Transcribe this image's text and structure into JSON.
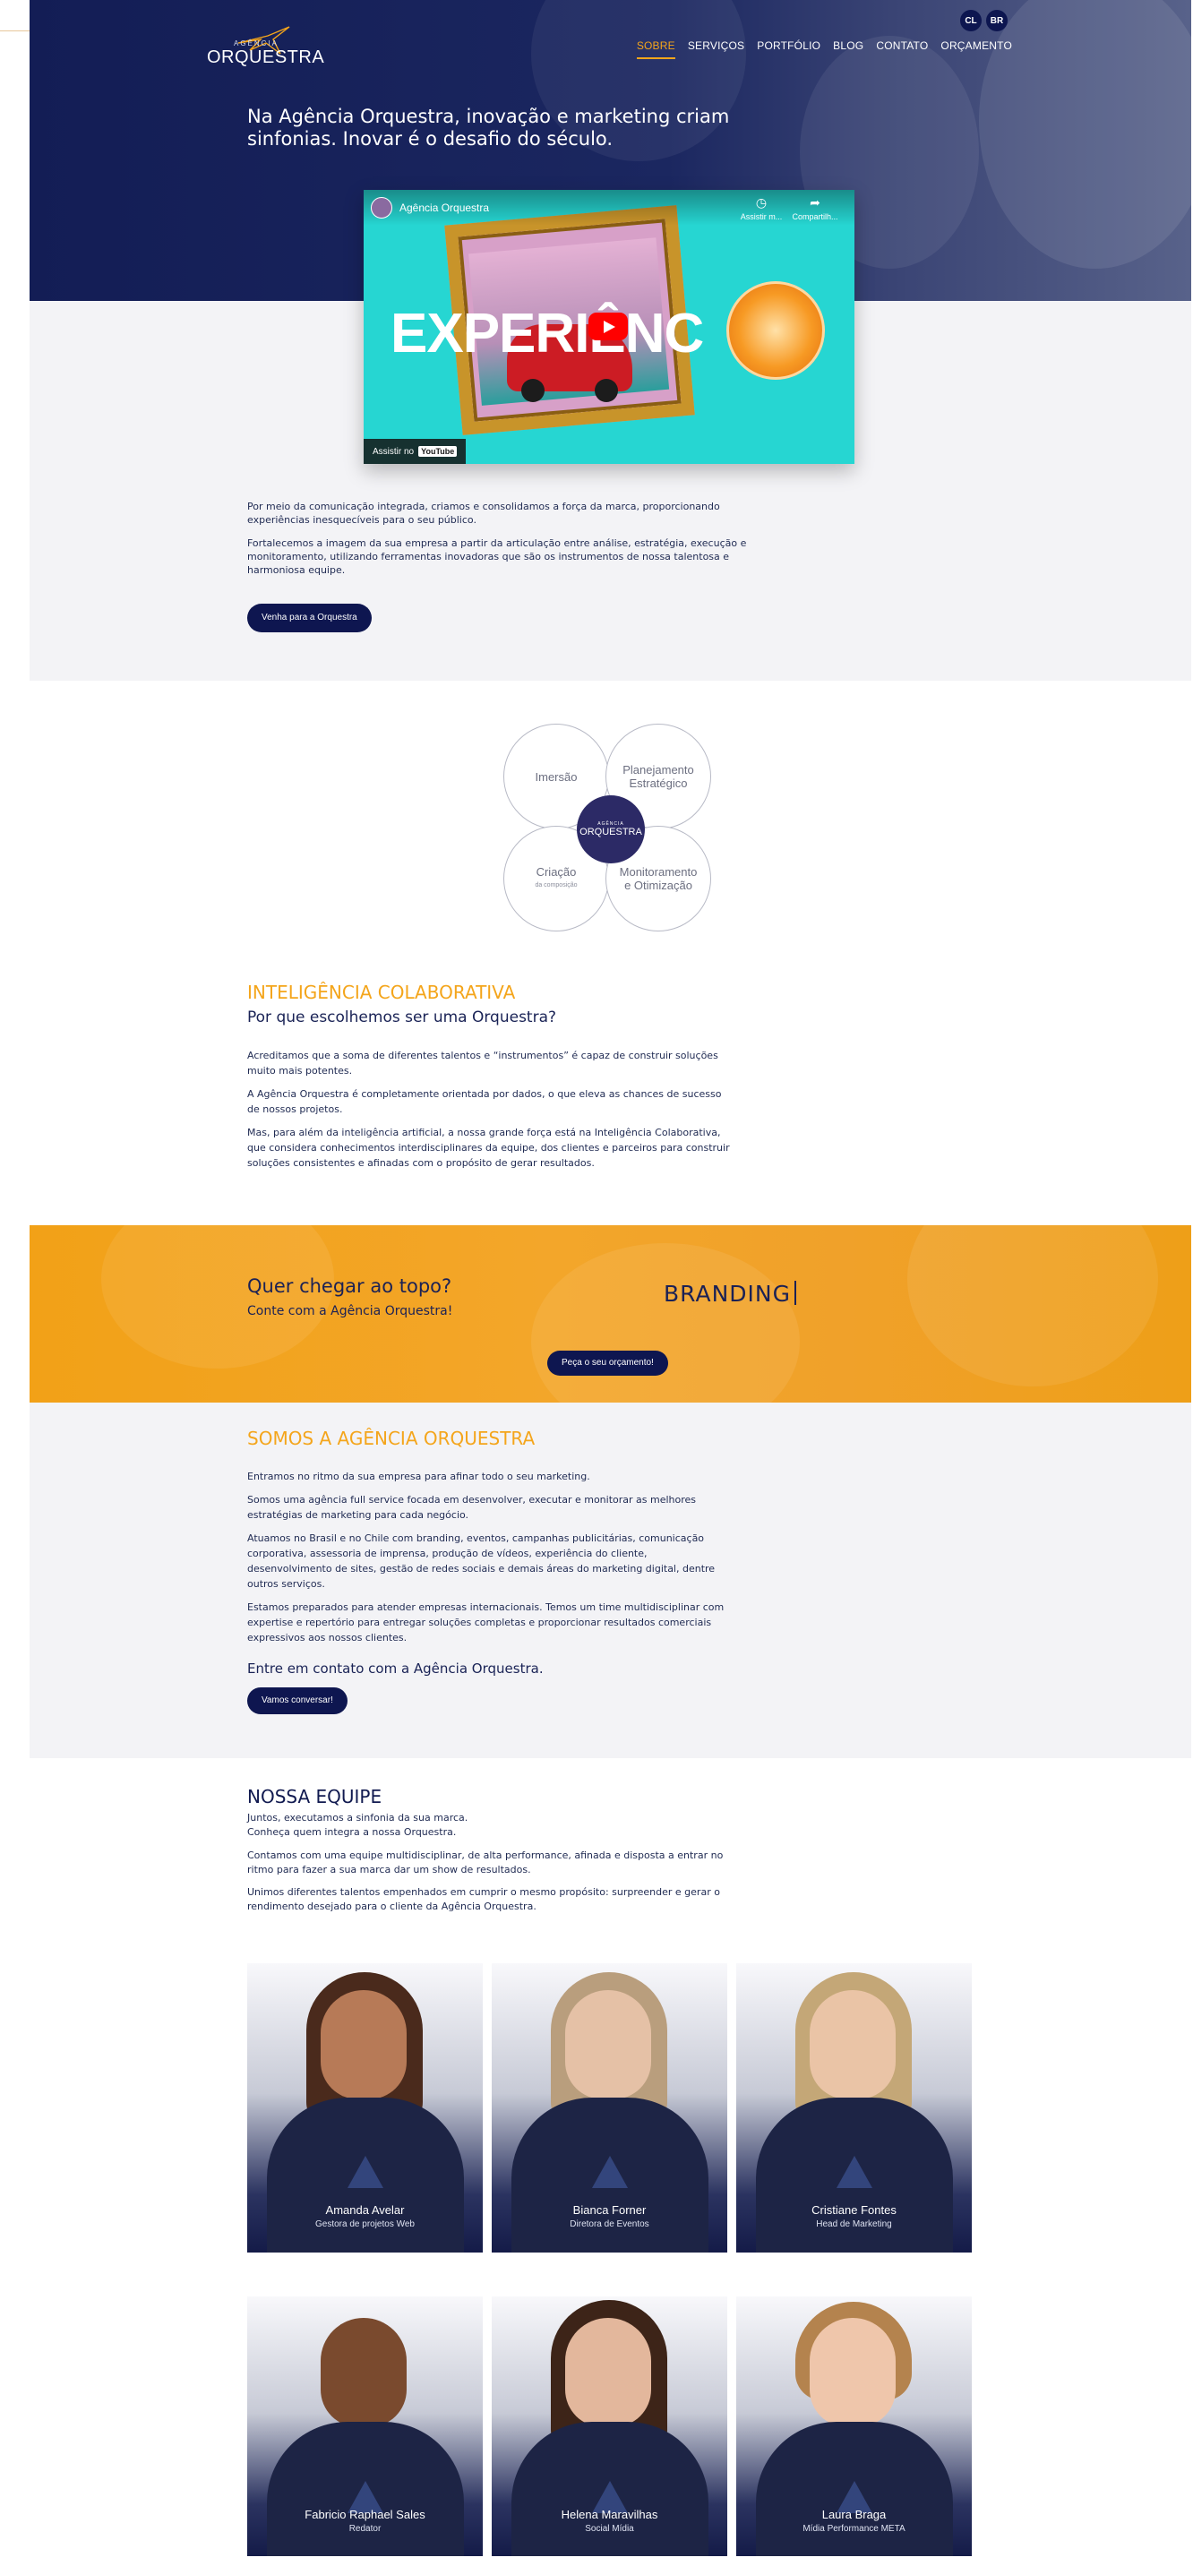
{
  "header": {
    "logo_small": "AGÊNCIA",
    "logo_big": "ORQUESTRA",
    "languages": [
      "CL",
      "BR"
    ],
    "nav": [
      {
        "label": "SOBRE",
        "active": true
      },
      {
        "label": "SERVIÇOS",
        "active": false
      },
      {
        "label": "PORTFÓLIO",
        "active": false
      },
      {
        "label": "BLOG",
        "active": false
      },
      {
        "label": "CONTATO",
        "active": false
      },
      {
        "label": "ORÇAMENTO",
        "active": false
      }
    ],
    "accent_color": "#f4a51b"
  },
  "hero": {
    "headline": "Na Agência Orquestra, inovação e marketing criam sinfonias. Inovar é o desafio do século."
  },
  "video": {
    "channel_title": "Agência Orquestra",
    "watch_later": "Assistir m...",
    "share": "Compartilh...",
    "overlay_text": "EXPERIÊNC",
    "watch_on": "Assistir no",
    "youtube": "YouTube"
  },
  "intro": {
    "p1": "Por meio da comunicação integrada, criamos e consolidamos a força da marca, proporcionando experiências inesquecíveis para o seu público.",
    "p2": "Fortalecemos a imagem da sua empresa a partir da articulação entre análise, estratégia, execução e monitoramento, utilizando ferramentas inovadoras que são os instrumentos de nossa talentosa e harmoniosa equipe.",
    "button": "Venha para a Orquestra"
  },
  "diagram": {
    "immersion": "Imersão",
    "planning": "Planejamento Estratégico",
    "creation": "Criação",
    "creation_sub": "da composição",
    "monitoring": "Monitoramento e Otimização",
    "center_small": "AGÊNCIA",
    "center_big": "ORQUESTRA"
  },
  "collab": {
    "title": "INTELIGÊNCIA COLABORATIVA",
    "subtitle": "Por que escolhemos ser uma Orquestra?",
    "p1": "Acreditamos que a soma de diferentes talentos e “instrumentos” é capaz de construir soluções muito mais potentes.",
    "p2": "A Agência Orquestra é completamente orientada por dados, o que eleva as chances de sucesso de nossos projetos.",
    "p3": "Mas, para além da inteligência artificial, a nossa grande força está na Inteligência Colaborativa, que considera conhecimentos interdisciplinares da equipe, dos clientes e parceiros para construir soluções consistentes e afinadas com o propósito de gerar resultados."
  },
  "band": {
    "title": "Quer chegar ao topo?",
    "subtitle": "Conte com a Agência Orquestra!",
    "typed_word": "BRANDING",
    "button": "Peça o seu orçamento!"
  },
  "about": {
    "title": "SOMOS A AGÊNCIA ORQUESTRA",
    "p1": "Entramos no ritmo da sua empresa para afinar todo o seu marketing.",
    "p2": "Somos uma agência full service focada em desenvolver, executar e monitorar as melhores estratégias de marketing para cada negócio.",
    "p3": "Atuamos no Brasil e no Chile com branding, eventos, campanhas publicitárias, comunicação corporativa, assessoria de imprensa, produção de vídeos, experiência do cliente, desenvolvimento de sites, gestão de redes sociais e demais áreas do marketing digital, dentre outros serviços.",
    "p4": "Estamos preparados para atender empresas internacionais. Temos um time multidisciplinar com expertise e repertório para entregar soluções completas e proporcionar resultados comerciais expressivos aos nossos clientes.",
    "contact_heading": "Entre em contato com a Agência Orquestra.",
    "button": "Vamos conversar!"
  },
  "team": {
    "title": "NOSSA EQUIPE",
    "p1_line1": "Juntos, executamos a sinfonia da sua marca.",
    "p1_line2": "Conheça quem integra a nossa Orquestra.",
    "p2": "Contamos com uma equipe multidisciplinar, de alta performance, afinada e disposta a entrar no ritmo para fazer a sua marca dar um show de resultados.",
    "p3": "Unimos diferentes talentos empenhados em cumprir o mesmo propósito: surpreender e gerar o rendimento desejado para o cliente da Agência Orquestra.",
    "members": [
      {
        "name": "Amanda Avelar",
        "role": "Gestora de projetos Web"
      },
      {
        "name": "Bianca Forner",
        "role": "Diretora de Eventos"
      },
      {
        "name": "Cristiane Fontes",
        "role": "Head de Marketing"
      },
      {
        "name": "Fabricio Raphael Sales",
        "role": "Redator"
      },
      {
        "name": "Helena Maravilhas",
        "role": "Social Mídia"
      },
      {
        "name": "Laura Braga",
        "role": "Mídia Performance META"
      }
    ]
  }
}
